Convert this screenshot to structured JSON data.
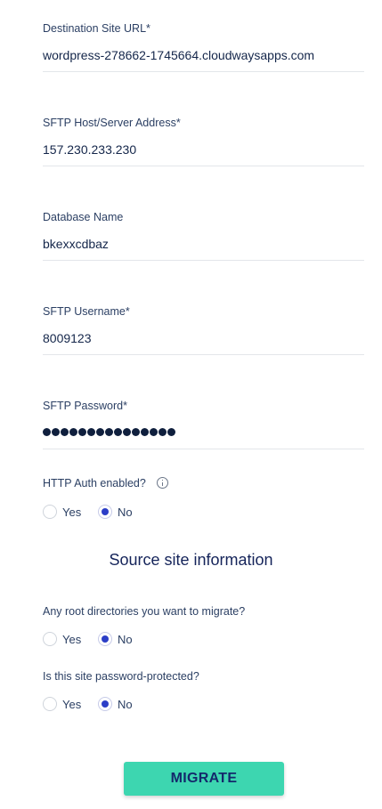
{
  "fields": [
    {
      "label": "Destination Site URL*",
      "value": "wordpress-278662-1745664.cloudwaysapps.com"
    },
    {
      "label": "SFTP Host/Server Address*",
      "value": "157.230.233.230"
    },
    {
      "label": "Database Name",
      "value": "bkexxcdbaz"
    },
    {
      "label": "SFTP Username*",
      "value": "8009123"
    },
    {
      "label": "SFTP Password*",
      "value": "●●●●●●●●●●●●●●●"
    }
  ],
  "http_auth": {
    "question": "HTTP Auth enabled?",
    "yes_label": "Yes",
    "no_label": "No",
    "selected": "No"
  },
  "source_section": {
    "heading": "Source site information"
  },
  "root_dirs": {
    "question": "Any root directories you want to migrate?",
    "yes_label": "Yes",
    "no_label": "No",
    "selected": "No"
  },
  "password_protected": {
    "question": "Is this site password-protected?",
    "yes_label": "Yes",
    "no_label": "No",
    "selected": "No"
  },
  "migrate_button": {
    "label": "MIGRATE"
  },
  "colors": {
    "accent": "#3dd6b0",
    "radio_selected": "#2c3ec7",
    "text_dark": "#14264a"
  }
}
